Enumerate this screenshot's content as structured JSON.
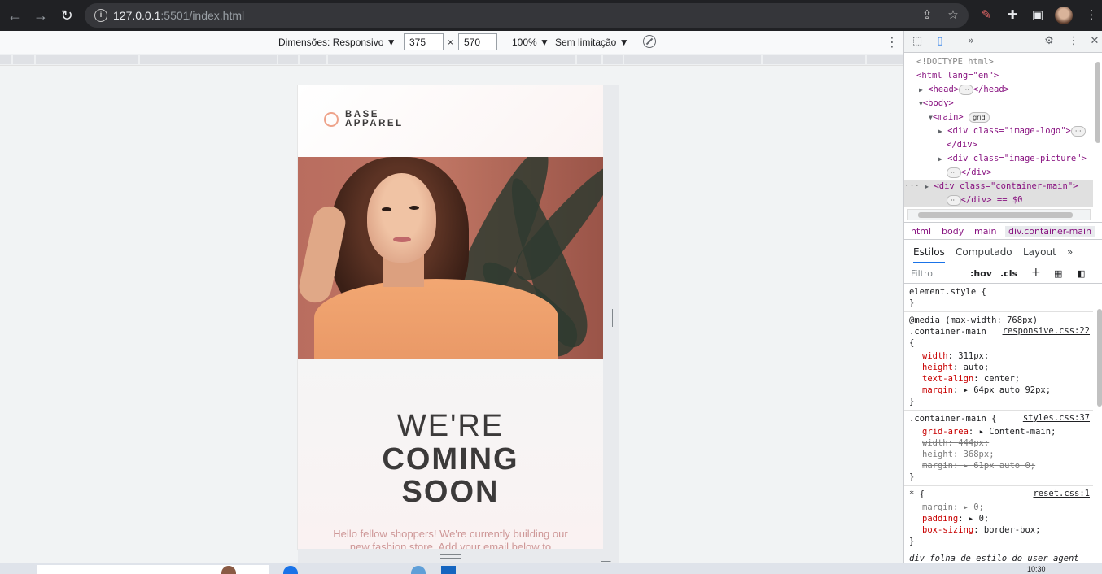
{
  "browser": {
    "url_host": "127.0.0.1",
    "url_rest": ":5501/index.html"
  },
  "device_toolbar": {
    "dimensions_label": "Dimensões: Responsivo ▼",
    "width": "375",
    "times": "×",
    "height": "570",
    "zoom": "100% ▼",
    "throttle": "Sem limitação ▼"
  },
  "site": {
    "logo_line1": "BASE",
    "logo_line2": "APPAREL",
    "headline_light": "WE'RE",
    "headline_bold1": "COMING",
    "headline_bold2": "SOON",
    "tagline": "Hello fellow shoppers! We're currently building our new fashion store. Add your email below to"
  },
  "devtools": {
    "tree": [
      "<!DOCTYPE html>",
      "<html lang=\"en\">",
      "<head>",
      "</head>",
      "<body>",
      "<main>",
      "grid",
      "<div class=\"image-logo\">",
      "</div>",
      "<div class=\"image-picture\">",
      "</div>",
      "<div class=\"container-main\">",
      "</div> == $0"
    ],
    "breadcrumbs": [
      "html",
      "body",
      "main",
      "div.container-main"
    ],
    "tabs": [
      "Estilos",
      "Computado",
      "Layout",
      "»"
    ],
    "filter_placeholder": "Filtro",
    "filter_tools": [
      ":hov",
      ".cls",
      "+"
    ],
    "rules": {
      "element_style": "element.style {",
      "close": "}",
      "media": "@media (max-width: 768px)",
      "container_main": ".container-main",
      "container_main_open": ".container-main {",
      "open_brace": "{",
      "responsive_src": "responsive.css:22",
      "styles_src": "styles.css:37",
      "reset_src": "reset.css:1",
      "universal": "* {",
      "user_agent": "div   folha de estilo do user agent",
      "responsive_props": [
        {
          "name": "width",
          "value": "311px;"
        },
        {
          "name": "height",
          "value": "auto;"
        },
        {
          "name": "text-align",
          "value": "center;"
        },
        {
          "name": "margin",
          "value": "▸ 64px auto 92px;"
        }
      ],
      "styles_props": [
        {
          "name": "grid-area",
          "value": "▸ Content-main;"
        },
        {
          "name": "width",
          "value": "444px;"
        },
        {
          "name": "height",
          "value": "368px;"
        },
        {
          "name": "margin",
          "value": "▸ 61px auto 0;"
        }
      ],
      "reset_props": [
        {
          "name": "margin",
          "value": "▸ 0;"
        },
        {
          "name": "padding",
          "value": "▸ 0;"
        },
        {
          "name": "box-sizing",
          "value": "border-box;"
        }
      ]
    }
  },
  "taskbar": {
    "clock": "10:30"
  },
  "colors": {
    "accent": "#1a73e8",
    "logo_ring": "#eea38a",
    "tagline": "#ce9797",
    "headline": "#3c3a3a"
  }
}
